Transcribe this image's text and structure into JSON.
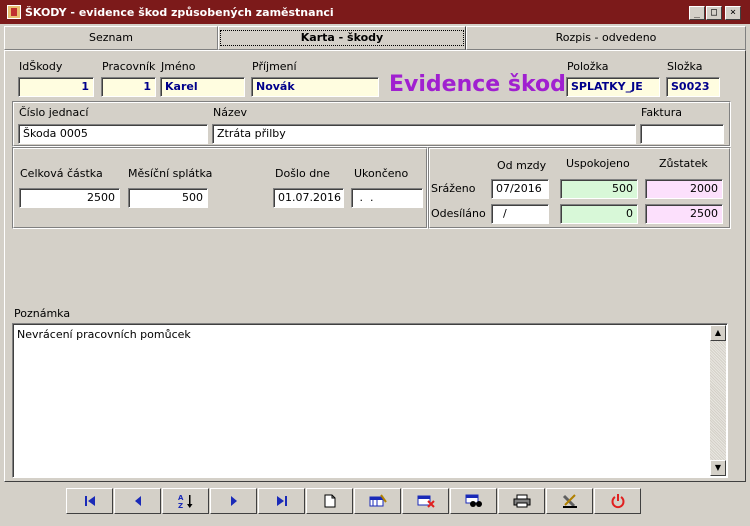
{
  "window": {
    "title": "ŠKODY - evidence škod způsobených zaměstnanci",
    "min_glyph": "_",
    "max_glyph": "□",
    "close_glyph": "×"
  },
  "tabs": [
    {
      "label": "Seznam"
    },
    {
      "label": "Karta - škody"
    },
    {
      "label": "Rozpis - odvedeno"
    }
  ],
  "header": {
    "id_label": "IdŠkody",
    "id_value": "1",
    "worker_label": "Pracovník",
    "worker_value": "1",
    "firstname_label": "Jméno",
    "firstname_value": "Karel",
    "lastname_label": "Příjmení",
    "lastname_value": "Novák",
    "big_title": "Evidence škod",
    "item_label": "Položka",
    "item_value": "SPLATKY_JE",
    "component_label": "Složka",
    "component_value": "S0023"
  },
  "ref": {
    "number_label": "Číslo jednací",
    "number_value": "Škoda 0005",
    "name_label": "Název",
    "name_value": "Ztráta přilby",
    "invoice_label": "Faktura",
    "invoice_value": ""
  },
  "amounts": {
    "total_label": "Celková částka",
    "total_value": "2500",
    "monthly_label": "Měsíční splátka",
    "monthly_value": "500",
    "arrived_label": "Došlo dne",
    "arrived_value": "01.07.2016",
    "ended_label": "Ukončeno",
    "ended_value": " .  ."
  },
  "deductions": {
    "from_wage_label": "Od mzdy",
    "paid_label": "Uspokojeno",
    "balance_label": "Zůstatek",
    "deducted_label": "Sráženo",
    "deducted_from": "07/2016",
    "deducted_paid": "500",
    "deducted_balance": "2000",
    "sent_label": "Odesíláno",
    "sent_from": "  /",
    "sent_paid": "0",
    "sent_balance": "2500"
  },
  "note": {
    "label": "Poznámka",
    "value": "Nevrácení pracovních pomůcek"
  },
  "toolbar": {
    "buttons": [
      {
        "icon": "first-record-icon"
      },
      {
        "icon": "prev-record-icon"
      },
      {
        "icon": "sort-az-icon"
      },
      {
        "icon": "next-record-icon"
      },
      {
        "icon": "last-record-icon"
      },
      {
        "icon": "new-record-icon"
      },
      {
        "icon": "edit-record-icon"
      },
      {
        "icon": "delete-record-icon"
      },
      {
        "icon": "find-icon"
      },
      {
        "icon": "print-icon"
      },
      {
        "icon": "tools-icon"
      },
      {
        "icon": "power-icon"
      }
    ]
  },
  "colors": {
    "titlebar": "#7c1a1a",
    "accent_title": "#a020d0",
    "field_yellow": "#fffde0",
    "field_green": "#d8f8d8",
    "field_pink": "#fce0fc",
    "toolbar_icon_blue": "#1a2ab8",
    "power_red": "#e02020"
  }
}
